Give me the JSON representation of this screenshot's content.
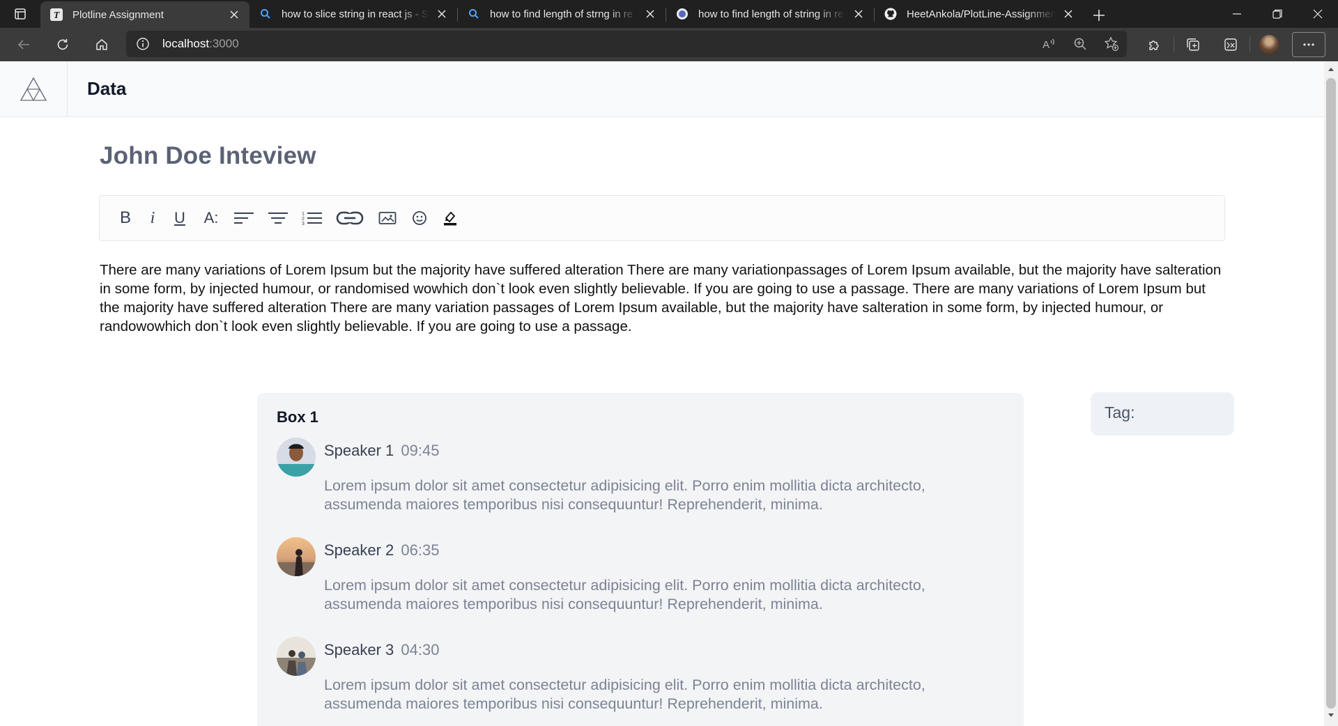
{
  "browser": {
    "tabs": [
      {
        "title": "Plotline Assignment",
        "favicon": "T",
        "active": true
      },
      {
        "title": "how to slice string in react js - Se",
        "favicon": "search-icon",
        "active": false
      },
      {
        "title": "how to find length of strng in re",
        "favicon": "search-icon",
        "active": false
      },
      {
        "title": "how to find length of string in re",
        "favicon": "circle-icon",
        "active": false
      },
      {
        "title": "HeetAnkola/PlotLine-Assignmen",
        "favicon": "github-icon",
        "active": false
      }
    ],
    "url_host": "localhost",
    "url_port": ":3000"
  },
  "app": {
    "header_title": "Data",
    "doc_title": "John Doe Inteview",
    "toolbar": {
      "bold": "B",
      "italic": "i",
      "underline": "U",
      "font_size": "A:"
    },
    "body": "There are many variations of Lorem Ipsum but the majority have suffered alteration There are many variationpassages of Lorem Ipsum available, but the majority have salteration in some form, by injected humour, or randomised wowhich don`t look even slightly believable. If you are going to use a passage. There are many variations of Lorem Ipsum but the majority have suffered alteration There are many variation passages of Lorem Ipsum available, but the majority have salteration in some form, by injected humour, or randowowhich don`t look even slightly believable. If you are going to use a passage.",
    "box": {
      "title": "Box 1",
      "entries": [
        {
          "speaker": "Speaker 1",
          "time": "09:45",
          "text": "Lorem ipsum dolor sit amet consectetur adipisicing elit. Porro enim mollitia dicta architecto, assumenda maiores temporibus nisi consequuntur! Reprehenderit, minima."
        },
        {
          "speaker": "Speaker 2",
          "time": "06:35",
          "text": "Lorem ipsum dolor sit amet consectetur adipisicing elit. Porro enim mollitia dicta architecto, assumenda maiores temporibus nisi consequuntur! Reprehenderit, minima."
        },
        {
          "speaker": "Speaker 3",
          "time": "04:30",
          "text": "Lorem ipsum dolor sit amet consectetur adipisicing elit. Porro enim mollitia dicta architecto, assumenda maiores temporibus nisi consequuntur! Reprehenderit, minima."
        }
      ]
    },
    "tag_label": "Tag:"
  },
  "colors": {
    "chrome_dark": "#202020",
    "chrome_toolbar": "#3b3b3b",
    "title_gray": "#5b6275",
    "muted_text": "#7b8394",
    "box_bg": "#f3f4f6",
    "tag_bg": "#eef2f7"
  }
}
